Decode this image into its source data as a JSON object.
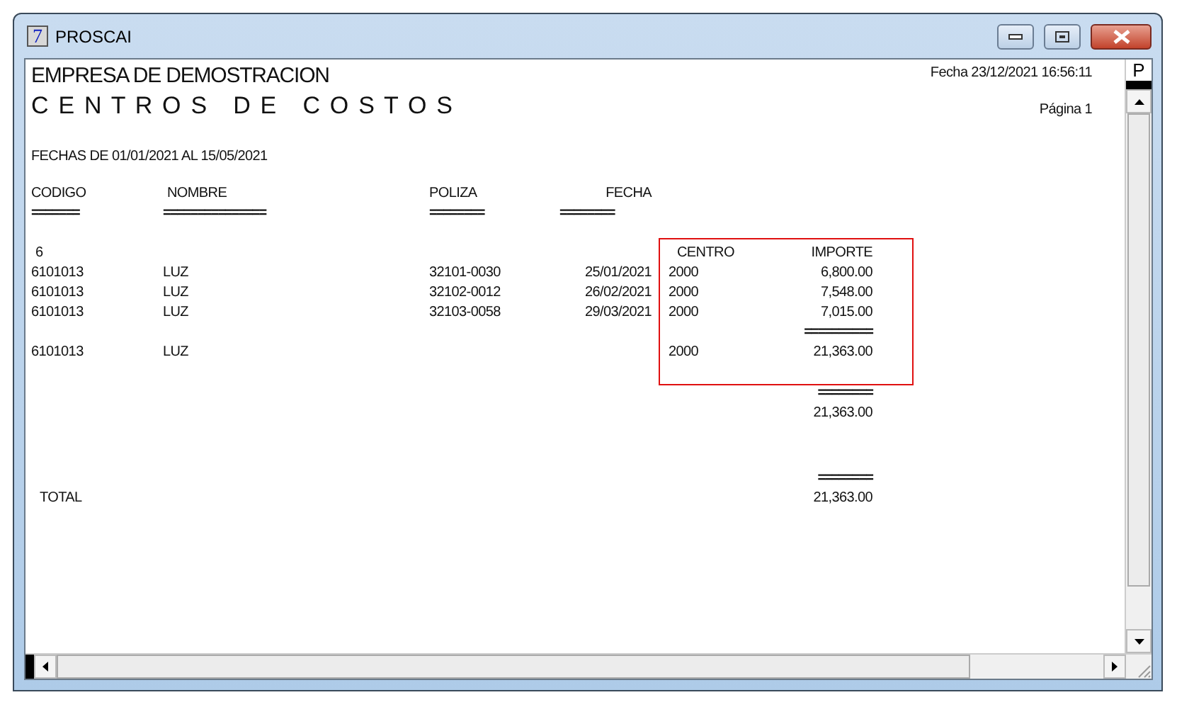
{
  "window": {
    "title": "PROSCAI",
    "app_icon": "7"
  },
  "report": {
    "company": "EMPRESA DE DEMOSTRACION",
    "title": "C E N T R O S   D E   C O S T O S",
    "date_line": "Fecha  23/12/2021 16:56:11",
    "page": "Página 1",
    "range": "FECHAS DE 01/01/2021  AL 15/05/2021",
    "columns": [
      {
        "label": "CODIGO",
        "underline": "======="
      },
      {
        "label": "NOMBRE",
        "underline": "==============="
      },
      {
        "label": "POLIZA",
        "underline": "========"
      },
      {
        "label": "FECHA",
        "underline": "========"
      }
    ],
    "group": "6",
    "detail_header": {
      "centro": "CENTRO",
      "importe": "IMPORTE"
    },
    "rows": [
      {
        "codigo": "6101013",
        "nombre": "LUZ",
        "poliza": "32101-0030",
        "fecha": "25/01/2021",
        "centro": "2000",
        "importe": "6,800.00"
      },
      {
        "codigo": "6101013",
        "nombre": "LUZ",
        "poliza": "32102-0012",
        "fecha": "26/02/2021",
        "centro": "2000",
        "importe": "7,548.00"
      },
      {
        "codigo": "6101013",
        "nombre": "LUZ",
        "poliza": "32103-0058",
        "fecha": "29/03/2021",
        "centro": "2000",
        "importe": "7,015.00"
      }
    ],
    "subtotal_rule": "==========",
    "subtotal": {
      "codigo": "6101013",
      "nombre": "LUZ",
      "centro": "2000",
      "importe": "21,363.00"
    },
    "group_rule": "========",
    "group_total": "21,363.00",
    "total_rule": "========",
    "total_label": "TOTAL",
    "total": "21,363.00"
  },
  "side_tab": "P"
}
